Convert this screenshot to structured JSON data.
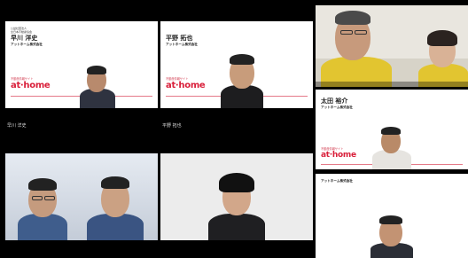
{
  "tiles": [
    {
      "id": "top-left",
      "cap1": "公益社団法人",
      "cap2": "全日本不動産協会",
      "cap3": "",
      "person_name": "早川 洋史",
      "company": "アットホーム株式会社",
      "brand_tag": "不動産情報サイト",
      "brand": "at·home",
      "label": "早川 洋史"
    },
    {
      "id": "top-middle",
      "cap1": "",
      "cap2": "",
      "cap3": "",
      "person_name": "平野 拓也",
      "company": "アットホーム株式会社",
      "brand_tag": "不動産情報サイト",
      "brand": "at·home",
      "label": "平野 拓也"
    },
    {
      "id": "top-right",
      "label": "",
      "label_strip": ""
    },
    {
      "id": "right-middle",
      "person_name": "太田 裕介",
      "company": "アットホーム株式会社",
      "brand_tag": "不動産情報サイト",
      "brand": "at·home",
      "label": ""
    },
    {
      "id": "bottom-left",
      "label": ""
    },
    {
      "id": "bottom-middle",
      "label": ""
    },
    {
      "id": "bottom-right",
      "person_name": "",
      "company": "アットホーム株式会社",
      "label": ""
    }
  ]
}
